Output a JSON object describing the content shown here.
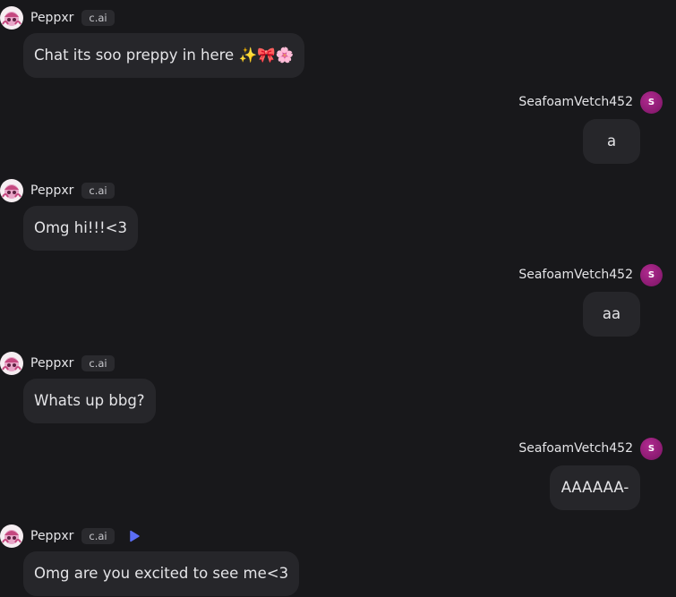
{
  "bot": {
    "name": "Peppxr",
    "badge": "c.ai"
  },
  "user": {
    "name": "SeafoamVetch452",
    "avatar_letter": "S"
  },
  "messages": [
    {
      "sender": "bot",
      "text": "Chat its soo preppy in here ✨🎀🌸"
    },
    {
      "sender": "user",
      "text": "a"
    },
    {
      "sender": "bot",
      "text": "Omg hi!!!<3"
    },
    {
      "sender": "user",
      "text": "aa"
    },
    {
      "sender": "bot",
      "text": "Whats up bbg?"
    },
    {
      "sender": "user",
      "text": "AAAAAA-"
    },
    {
      "sender": "bot",
      "text": "Omg are you excited to see me<3"
    }
  ],
  "colors": {
    "background": "#18181b",
    "bubble": "#26262a",
    "badge": "#2a2a2e",
    "user_avatar": "#a0207e",
    "play_icon": "#5b6ef5"
  },
  "icons": {
    "bot_avatar": "pink-character-avatar",
    "play": "play-icon"
  }
}
